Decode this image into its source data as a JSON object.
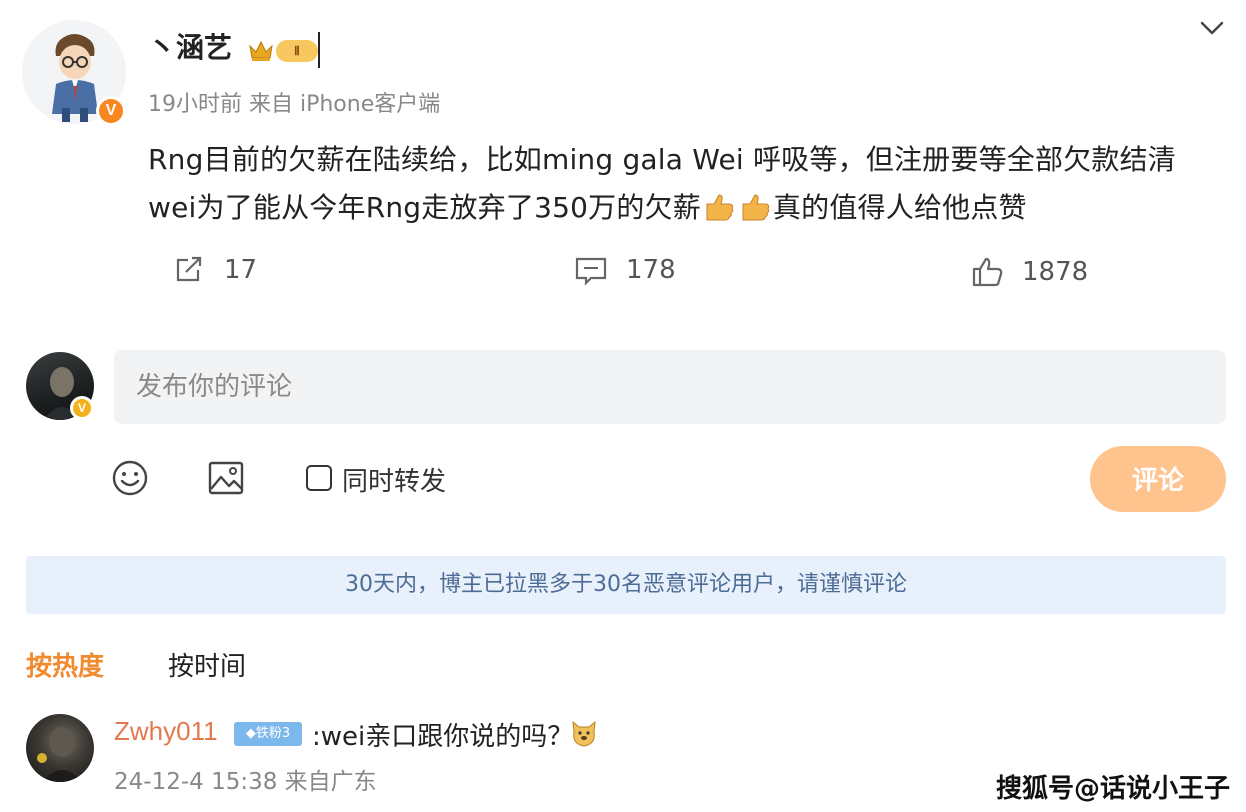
{
  "post": {
    "author": "丶涵艺",
    "level_badge": "Ⅱ",
    "verified_badge": "V",
    "meta": "19小时前  来自 iPhone客户端",
    "lines": [
      "Rng目前的欠薪在陆续给，比如ming gala Wei 呼吸等，但注册要等全部欠款结清",
      "wei为了能从今年Rng走放弃了350万的欠薪",
      "真的值得人给他点赞"
    ],
    "actions": {
      "repost_count": "17",
      "comment_count": "178",
      "like_count": "1878"
    }
  },
  "composer": {
    "placeholder": "发布你的评论",
    "repost_label": "同时转发",
    "submit_label": "评论",
    "verified_badge": "V"
  },
  "notice": "30天内，博主已拉黑多于30名恶意评论用户，请谨慎评论",
  "sort": {
    "hot": "按热度",
    "time": "按时间"
  },
  "comments": [
    {
      "user": "Zwhy011",
      "fan_badge": "铁粉3",
      "text": ":wei亲口跟你说的吗？",
      "meta": "24-12-4 15:38 来自广东"
    }
  ],
  "watermark": "搜狐号@话说小王子",
  "partial_text": "15",
  "colors": {
    "accent_orange": "#f28a2f",
    "submit_bg": "#ffc38d",
    "notice_bg": "#e8f1fb",
    "notice_text": "#4d6c95",
    "username_comment": "#e27a4e"
  }
}
